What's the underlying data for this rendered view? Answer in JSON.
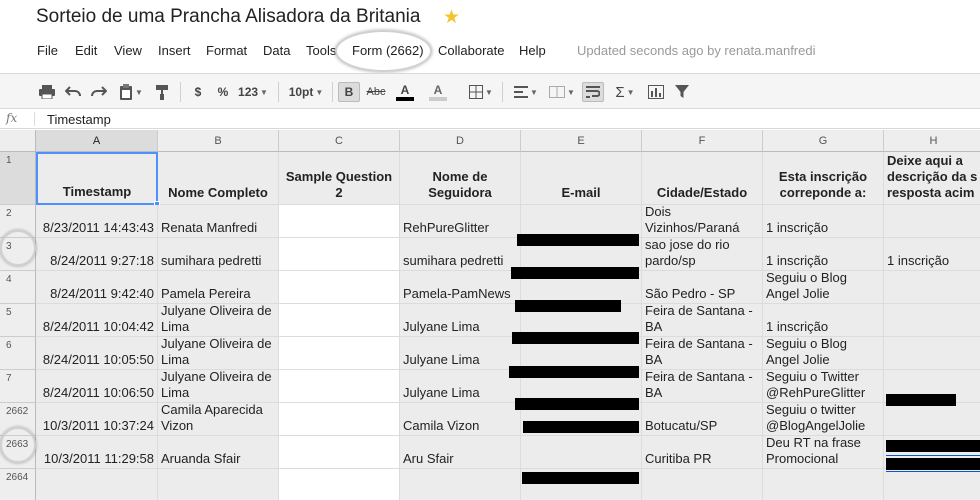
{
  "document": {
    "title": "Sorteio de uma Prancha Alisadora da Britania"
  },
  "menu": {
    "items": [
      "File",
      "Edit",
      "View",
      "Insert",
      "Format",
      "Data",
      "Tools",
      "Form (2662)",
      "Collaborate",
      "Help"
    ],
    "status": "Updated seconds ago by renata.manfredi"
  },
  "toolbar": {
    "currency": "$",
    "percent": "%",
    "number_format": "123",
    "font_size": "10pt",
    "bold": "B",
    "strikethrough": "Abc",
    "text_color": "A",
    "fill_color": "A",
    "sum": "Σ",
    "icons": [
      "print-icon",
      "undo-icon",
      "redo-icon",
      "paste-icon",
      "paint-format-icon",
      "borders-icon",
      "align-left-icon",
      "merge-cells-icon",
      "wrap-text-icon",
      "sum-icon",
      "chart-icon",
      "filter-icon"
    ]
  },
  "formula_bar": {
    "label": "fx",
    "value": "Timestamp"
  },
  "sheet": {
    "columns": [
      "A",
      "B",
      "C",
      "D",
      "E",
      "F",
      "G",
      "H"
    ],
    "header_row_number": "1",
    "headers": [
      "Timestamp",
      "Nome Completo",
      "Sample Question 2",
      "Nome de Seguidora",
      "E-mail",
      "Cidade/Estado",
      "Esta inscrição correponde a:",
      "Deixe aqui a descrição da s resposta acim"
    ],
    "rows": [
      {
        "num": "2",
        "timestamp": "8/23/2011 14:43:43",
        "nome": "Renata Manfredi",
        "sample": "",
        "seguidora": "RehPureGlitter",
        "email": "",
        "cidade": "Dois Vizinhos/Paraná",
        "inscricao": "1 inscrição",
        "descricao": ""
      },
      {
        "num": "3",
        "timestamp": "8/24/2011 9:27:18",
        "nome": "sumihara pedretti",
        "sample": "",
        "seguidora": "sumihara pedretti",
        "email": "",
        "cidade": "sao jose do rio pardo/sp",
        "inscricao": "1 inscrição",
        "descricao": "1 inscrição"
      },
      {
        "num": "4",
        "timestamp": "8/24/2011 9:42:40",
        "nome": "Pamela Pereira",
        "sample": "",
        "seguidora": "Pamela-PamNews",
        "email": "",
        "cidade": "São Pedro - SP",
        "inscricao": "Seguiu o Blog Angel Jolie",
        "descricao": ""
      },
      {
        "num": "5",
        "timestamp": "8/24/2011 10:04:42",
        "nome": "Julyane Oliveira de Lima",
        "sample": "",
        "seguidora": "Julyane Lima",
        "email": "",
        "cidade": "Feira de Santana - BA",
        "inscricao": "1 inscrição",
        "descricao": ""
      },
      {
        "num": "6",
        "timestamp": "8/24/2011 10:05:50",
        "nome": "Julyane Oliveira de Lima",
        "sample": "",
        "seguidora": "Julyane Lima",
        "email": "",
        "cidade": "Feira de Santana - BA",
        "inscricao": "Seguiu o Blog Angel Jolie",
        "descricao": ""
      },
      {
        "num": "7",
        "timestamp": "8/24/2011 10:06:50",
        "nome": "Julyane Oliveira de Lima",
        "sample": "",
        "seguidora": "Julyane Lima",
        "email": "",
        "cidade": "Feira de Santana - BA",
        "inscricao": "Seguiu o Twitter @RehPureGlitter",
        "descricao": ""
      },
      {
        "num": "2662",
        "timestamp": "10/3/2011 10:37:24",
        "nome": "Camila Aparecida Vizon",
        "sample": "",
        "seguidora": "Camila Vizon",
        "email": "",
        "cidade": "Botucatu/SP",
        "inscricao": "Seguiu o twitter @BlogAngelJolie",
        "descricao": ""
      },
      {
        "num": "2663",
        "timestamp": "10/3/2011 11:29:58",
        "nome": "Aruanda Sfair",
        "sample": "",
        "seguidora": "Aru Sfair",
        "email": "",
        "cidade": "Curitiba PR",
        "inscricao": "Deu RT na frase Promocional",
        "descricao": ""
      },
      {
        "num": "2664",
        "timestamp": "",
        "nome": "",
        "sample": "",
        "seguidora": "",
        "email": "",
        "cidade": "",
        "inscricao": "",
        "descricao": ""
      }
    ]
  }
}
